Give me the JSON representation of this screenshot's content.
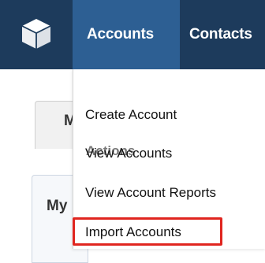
{
  "nav": {
    "logo_icon": "cube-icon",
    "tabs": [
      {
        "label": "Accounts",
        "active": true
      },
      {
        "label": "Contacts",
        "active": false
      }
    ]
  },
  "background": {
    "tab_letter": "M",
    "panel_label": "My"
  },
  "dropdown": {
    "header": "Actions",
    "items": [
      {
        "label": "Create Account"
      },
      {
        "label": "View Accounts"
      },
      {
        "label": "View Account Reports"
      },
      {
        "label": "Import Accounts",
        "highlighted": true
      }
    ]
  },
  "colors": {
    "navbar": "#1d3b5c",
    "active_tab": "#2d5f93",
    "highlight": "#e0251f"
  }
}
